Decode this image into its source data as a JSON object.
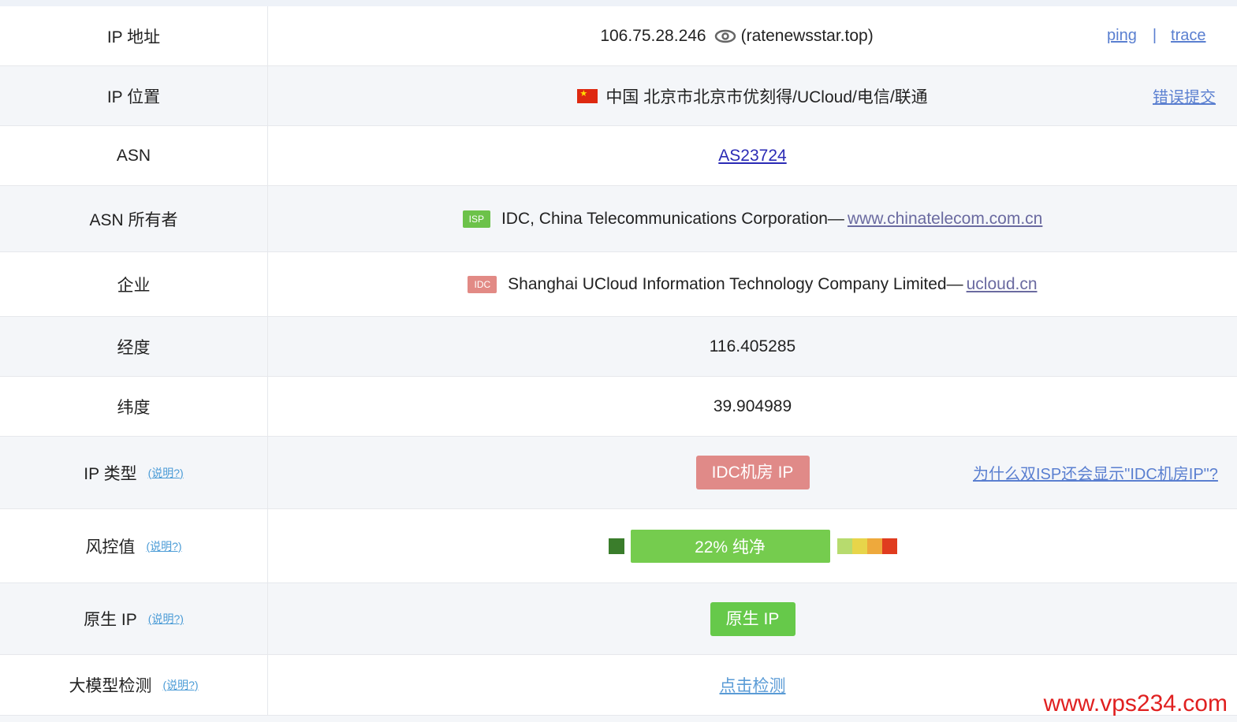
{
  "rows": {
    "ip": {
      "label": "IP 地址",
      "value": "106.75.28.246",
      "host": "(ratenewsstar.top)",
      "ping": "ping",
      "sep": "|",
      "trace": "trace"
    },
    "location": {
      "label": "IP 位置",
      "value": "中国 北京市北京市优刻得/UCloud/电信/联通",
      "report": "错误提交",
      "flag_icon": "china-flag-icon"
    },
    "asn": {
      "label": "ASN",
      "value": "AS23724"
    },
    "asn_owner": {
      "label": "ASN 所有者",
      "badge": "ISP",
      "name": "IDC, China Telecommunications Corporation—",
      "url": "www.chinatelecom.com.cn"
    },
    "company": {
      "label": "企业",
      "badge": "IDC",
      "name": "Shanghai UCloud Information Technology Company Limited—",
      "url": "ucloud.cn"
    },
    "longitude": {
      "label": "经度",
      "value": "116.405285"
    },
    "latitude": {
      "label": "纬度",
      "value": "39.904989"
    },
    "ip_type": {
      "label": "IP 类型",
      "help": "(说明?)",
      "value": "IDC机房 IP",
      "link": "为什么双ISP还会显示\"IDC机房IP\"?"
    },
    "risk": {
      "label": "风控值",
      "help": "(说明?)",
      "value": "22%  纯净",
      "score_percent": 22,
      "colors": [
        "#3a7d2b",
        "#75cc4e",
        "#b7db6e",
        "#e7d54a",
        "#eea93c",
        "#e03c1f"
      ]
    },
    "native": {
      "label": "原生 IP",
      "help": "(说明?)",
      "value": "原生 IP"
    },
    "llm": {
      "label": "大模型检测",
      "help": "(说明?)",
      "value": "点击检测"
    }
  },
  "watermark": "www.vps234.com"
}
